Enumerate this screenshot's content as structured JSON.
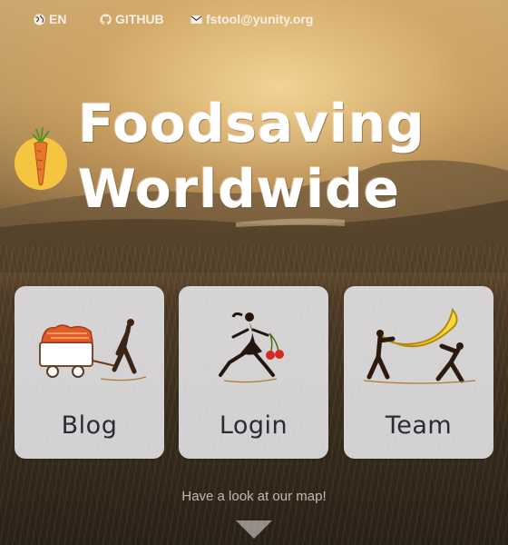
{
  "nav": {
    "language": {
      "label": "EN",
      "icon": "globe-icon"
    },
    "github": {
      "label": "GITHUB",
      "icon": "github-icon"
    },
    "email": {
      "label": "fstool@yunity.org",
      "icon": "envelope-icon"
    }
  },
  "hero": {
    "title_line1": "Foodsaving",
    "title_line2": "Worldwide",
    "logo": "carrot-logo"
  },
  "cards": [
    {
      "label": "Blog",
      "icon": "cart-walker-illustration"
    },
    {
      "label": "Login",
      "icon": "cherries-runner-illustration"
    },
    {
      "label": "Team",
      "icon": "banana-carriers-illustration"
    }
  ],
  "map_prompt": "Have a look at our map!",
  "colors": {
    "card_bg": "#e8e8ec",
    "title": "#ffffff",
    "carrot": "#e8772e",
    "logo_circle": "#f5c542"
  }
}
